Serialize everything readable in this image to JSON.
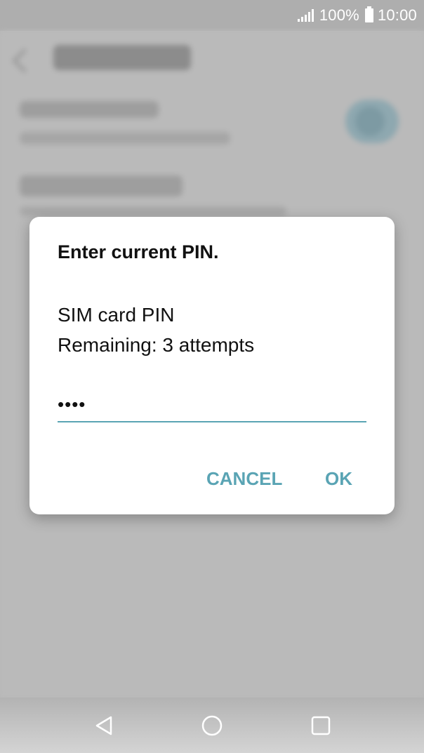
{
  "status_bar": {
    "battery": "100%",
    "time": "10:00",
    "icons": [
      "signal-icon",
      "battery-icon"
    ]
  },
  "dialog": {
    "title": "Enter current PIN.",
    "message_line1": "SIM card PIN",
    "message_line2": "Remaining: 3 attempts",
    "pin_value": "••••",
    "cancel_label": "CANCEL",
    "ok_label": "OK"
  },
  "nav_bar": {
    "icons": [
      "back-icon",
      "home-icon",
      "recent-apps-icon"
    ]
  },
  "colors": {
    "accent": "#5aa4b4",
    "dialog_background": "#ffffff",
    "scrim": "#b8b8b8"
  }
}
